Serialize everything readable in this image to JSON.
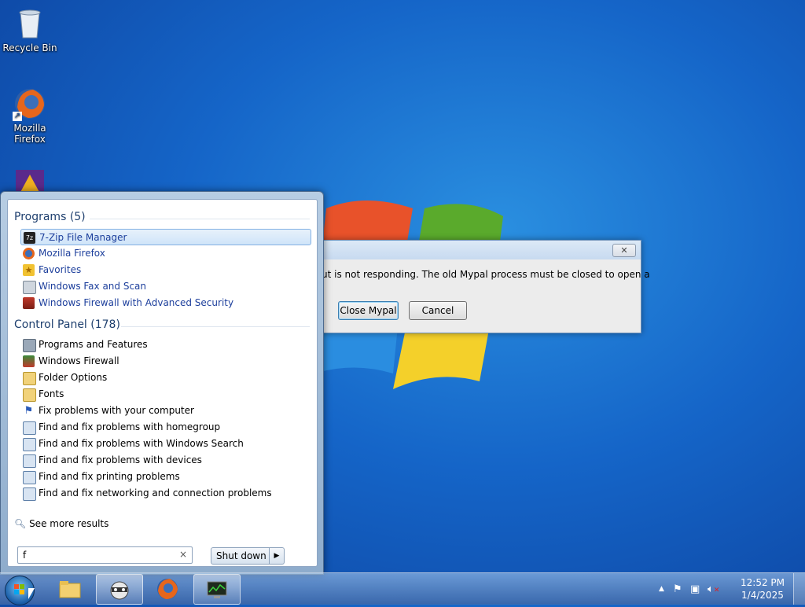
{
  "desktop": {
    "icons": [
      {
        "label": "Recycle Bin",
        "icon": "recycle-bin-icon"
      },
      {
        "label": "Mozilla\nFirefox",
        "icon": "firefox-icon"
      },
      {
        "label": "",
        "icon": "app-icon"
      }
    ]
  },
  "dialog": {
    "message": "ut is not responding. The old Mypal process must be closed to open a",
    "close_button_label": "Close Mypal",
    "cancel_button_label": "Cancel",
    "close_glyph": "✕"
  },
  "start_menu": {
    "programs_header": "Programs (5)",
    "programs": [
      {
        "label": "7-Zip File Manager",
        "icon": "7zip-icon",
        "selected": true
      },
      {
        "label": "Mozilla Firefox",
        "icon": "firefox-icon"
      },
      {
        "label": "Favorites",
        "icon": "favorites-icon"
      },
      {
        "label": "Windows Fax and Scan",
        "icon": "fax-icon"
      },
      {
        "label": "Windows Firewall with Advanced Security",
        "icon": "firewall-icon"
      }
    ],
    "control_panel_header": "Control Panel (178)",
    "control_panel": [
      {
        "label": "Programs and Features",
        "icon": "programs-features-icon"
      },
      {
        "label": "Windows Firewall",
        "icon": "firewall-icon"
      },
      {
        "label": "Folder Options",
        "icon": "folder-options-icon"
      },
      {
        "label": "Fonts",
        "icon": "fonts-icon"
      },
      {
        "label": "Fix problems with your computer",
        "icon": "flag-icon"
      },
      {
        "label": "Find and fix problems with homegroup",
        "icon": "troubleshoot-icon"
      },
      {
        "label": "Find and fix problems with Windows Search",
        "icon": "troubleshoot-icon"
      },
      {
        "label": "Find and fix problems with devices",
        "icon": "troubleshoot-icon"
      },
      {
        "label": "Find and fix printing problems",
        "icon": "troubleshoot-icon"
      },
      {
        "label": "Find and fix networking and connection problems",
        "icon": "troubleshoot-icon"
      }
    ],
    "see_more": "See more results",
    "search_value": "f",
    "search_clear": "×",
    "shutdown_label": "Shut down",
    "shutdown_arrow": "▶"
  },
  "taskbar": {
    "items": [
      {
        "name": "explorer",
        "icon": "folder-icon"
      },
      {
        "name": "mypal",
        "icon": "raccoon-icon",
        "active": true
      },
      {
        "name": "firefox",
        "icon": "firefox-icon"
      },
      {
        "name": "task-manager",
        "icon": "monitor-icon",
        "active": true
      }
    ],
    "tray": {
      "show_hidden": "▲",
      "time": "12:52 PM",
      "date": "1/4/2025"
    }
  },
  "colors": {
    "desktop_blue": "#1565c8",
    "link_blue": "#1d3f9c",
    "header_blue": "#1e3f6e",
    "selection": "#cfe4f9"
  }
}
